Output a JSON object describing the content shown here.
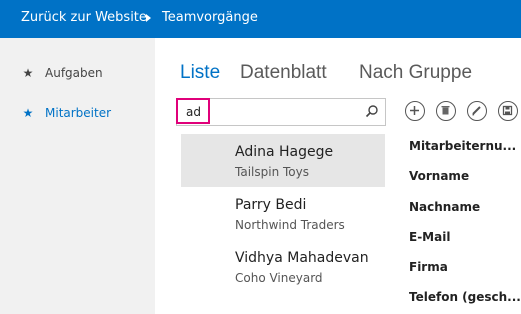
{
  "topbar": {
    "back_label": "Zurück zur Website",
    "title": "Teamvorgänge"
  },
  "sidebar": {
    "items": [
      {
        "label": "Aufgaben",
        "icon": "star-icon",
        "active": false
      },
      {
        "label": "Mitarbeiter",
        "icon": "star-icon",
        "active": true
      }
    ]
  },
  "views": {
    "tabs": [
      {
        "label": "Liste",
        "active": true
      },
      {
        "label": "Datenblatt",
        "active": false
      },
      {
        "label": "Nach Gruppe",
        "active": false
      }
    ]
  },
  "search": {
    "value": "ad"
  },
  "toolbar": {
    "icons": [
      "add-icon",
      "delete-icon",
      "edit-icon",
      "save-icon"
    ]
  },
  "list": {
    "items": [
      {
        "name": "Adina Hagege",
        "company": "Tailspin Toys",
        "selected": true
      },
      {
        "name": "Parry Bedi",
        "company": "Northwind Traders",
        "selected": false
      },
      {
        "name": "Vidhya Mahadevan",
        "company": "Coho Vineyard",
        "selected": false
      }
    ]
  },
  "detail": {
    "fields": [
      "Mitarbeiternu...",
      "Vorname",
      "Nachname",
      "E-Mail",
      "Firma",
      "Telefon (gesch..."
    ]
  },
  "colors": {
    "accent": "#0072c6",
    "highlight": "#e0007a",
    "sidebar_bg": "#f1f1f1",
    "selected_bg": "#e6e6e6"
  }
}
